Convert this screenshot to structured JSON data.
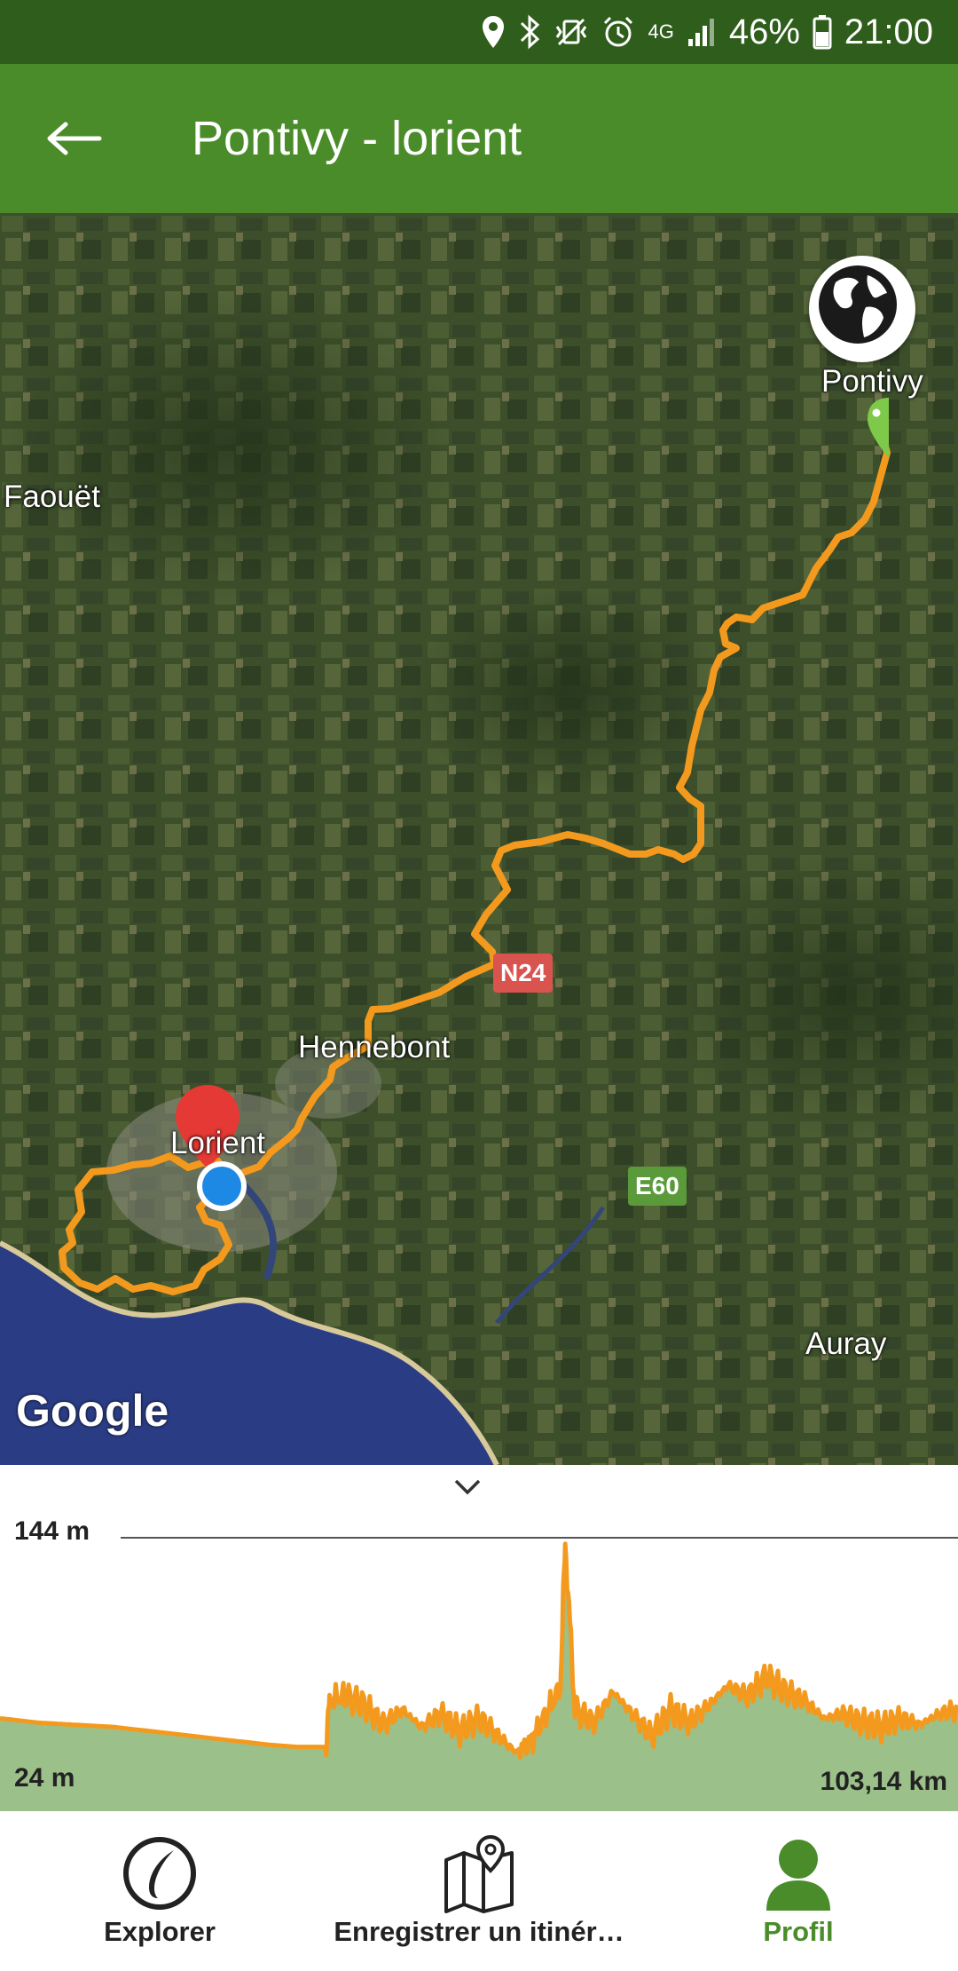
{
  "status_bar": {
    "network": "4G",
    "battery": "46%",
    "time": "21:00",
    "icons": [
      "location-icon",
      "bluetooth-icon",
      "vibrate-mute-icon",
      "alarm-icon",
      "network-icon",
      "signal-icon",
      "battery-icon"
    ]
  },
  "app_bar": {
    "title": "Pontivy - lorient",
    "back_icon": "arrow-left-icon"
  },
  "map": {
    "places": {
      "pontivy": "Pontivy",
      "faouet": "Faouët",
      "hennebont": "Hennebont",
      "lorient": "Lorient",
      "auray": "Auray"
    },
    "roads": {
      "n24": "N24",
      "e60": "E60"
    },
    "attribution": "Google",
    "globe_icon": "globe-icon",
    "colors": {
      "route": "#f39a1e",
      "start_pin": "#7ec84a",
      "end_pin": "#e53935",
      "location_dot": "#1e88e5",
      "n24_badge": "#d9534f",
      "e60_badge": "#5a9a3a"
    }
  },
  "elevation": {
    "max_label": "144 m",
    "min_label": "24 m",
    "distance_label": "103,14 km",
    "collapse_icon": "chevron-down-icon",
    "colors": {
      "line": "#f39a1e",
      "fill": "#9cc08a"
    }
  },
  "bottom_nav": {
    "items": [
      {
        "label": "Explorer",
        "icon": "explorer-icon",
        "active": false
      },
      {
        "label": "Enregistrer un itinér…",
        "icon": "map-pin-icon",
        "active": false
      },
      {
        "label": "Profil",
        "icon": "user-icon",
        "active": true
      }
    ],
    "active_color": "#4a8c2a"
  }
}
